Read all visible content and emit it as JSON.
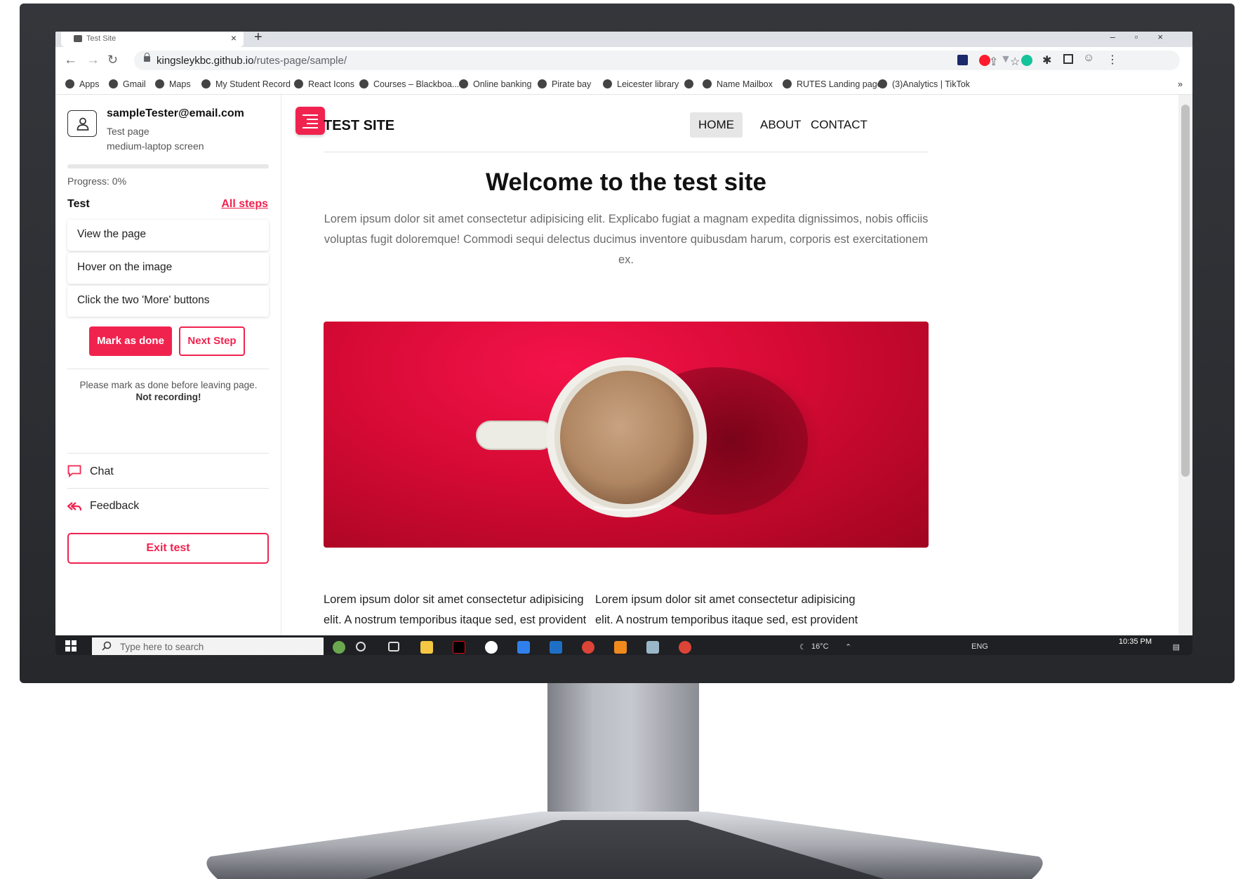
{
  "browser": {
    "tab_title": "Test Site",
    "url_domain": "kingsleykbc.github.io",
    "url_path": "/rutes-page/sample/",
    "bookmarks": [
      {
        "label": "Apps",
        "icon": "apps-grid-icon"
      },
      {
        "label": "Gmail",
        "icon": "gmail-icon"
      },
      {
        "label": "Maps",
        "icon": "maps-pin-icon"
      },
      {
        "label": "My Student Record",
        "icon": "globe-icon"
      },
      {
        "label": "React Icons",
        "icon": "globe-icon"
      },
      {
        "label": "Courses – Blackboa...",
        "icon": "blackboard-icon"
      },
      {
        "label": "Online banking",
        "icon": "globe-icon"
      },
      {
        "label": "Pirate bay",
        "icon": "ship-icon"
      },
      {
        "label": "Leicester library",
        "icon": "shield-icon"
      },
      {
        "label": "",
        "icon": "globe-icon"
      },
      {
        "label": "Name Mailbox",
        "icon": "cube-icon"
      },
      {
        "label": "RUTES Landing page",
        "icon": "flask-icon"
      },
      {
        "label": "(3)Analytics | TikTok",
        "icon": "tiktok-icon"
      }
    ],
    "more_bookmarks": "»"
  },
  "sidebar": {
    "email": "sampleTester@email.com",
    "page_name": "Test page",
    "screen_type": "medium-laptop screen",
    "progress_value": 0,
    "progress_label": "Progress: 0%",
    "test_label": "Test",
    "all_steps_label": "All steps",
    "steps": [
      "View the page",
      "Hover on the image",
      "Click the two 'More' buttons"
    ],
    "mark_done_label": "Mark as done",
    "next_step_label": "Next Step",
    "note_text": "Please mark as done before leaving page.",
    "note_bold": "Not recording!",
    "chat_label": "Chat",
    "feedback_label": "Feedback",
    "exit_label": "Exit test"
  },
  "site": {
    "logo": "TEST SITE",
    "nav": [
      "HOME",
      "ABOUT",
      "CONTACT"
    ],
    "title": "Welcome to the test site",
    "intro": "Lorem ipsum dolor sit amet consectetur adipisicing elit. Explicabo fugiat a magnam expedita dignissimos, nobis officiis voluptas fugit doloremque! Commodi sequi delectus ducimus inventore quibusdam harum, corporis est exercitationem ex.",
    "col1": "Lorem ipsum dolor sit amet consectetur adipisicing elit. A nostrum temporibus itaque sed, est provident aliquam dolorum? Ipsa, sequi quod doloremque",
    "col2": "Lorem ipsum dolor sit amet consectetur adipisicing elit. A nostrum temporibus itaque sed, est provident aliquam dolorum? Ipsa, sequi quod doloremque"
  },
  "taskbar": {
    "search_placeholder": "Type here to search",
    "weather": "16°C",
    "language": "ENG",
    "time": "10:35 PM"
  },
  "colors": {
    "accent": "#f0234f",
    "monitor": "#2b2d31"
  }
}
